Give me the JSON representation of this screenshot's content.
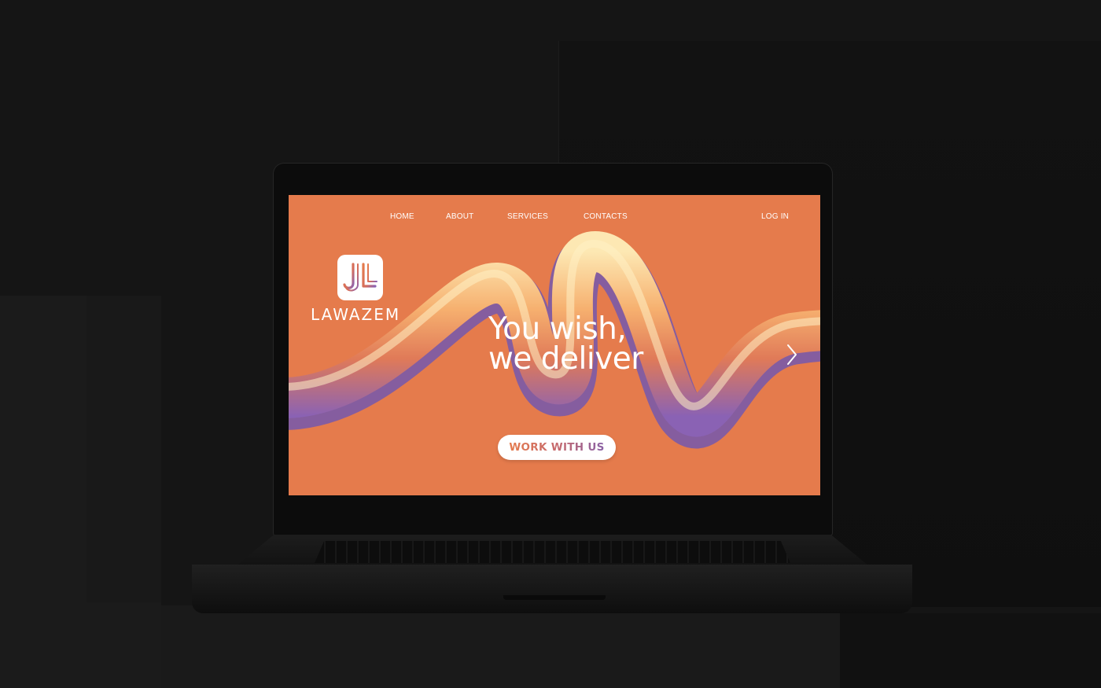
{
  "nav": {
    "home": "HOME",
    "about": "ABOUT",
    "services": "SERVICES",
    "contacts": "CONTACTS",
    "login": "LOG IN"
  },
  "brand": {
    "name": "LAWAZEM"
  },
  "hero": {
    "headline_line1": "You wish,",
    "headline_line2": "we deliver",
    "cta_label": "WORK WITH US"
  },
  "colors": {
    "background": "#e57b4c",
    "ribbon_light": "#fbe3a8",
    "ribbon_purple": "#8a62b4",
    "text": "#ffffff"
  },
  "icons": {
    "logo": "lawazem-logo-icon",
    "next": "chevron-right-icon"
  }
}
